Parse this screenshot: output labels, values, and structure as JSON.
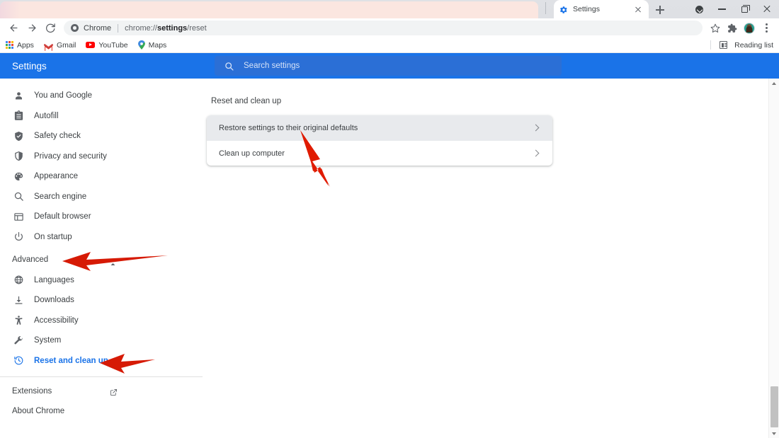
{
  "browser": {
    "tab": {
      "title": "Settings",
      "favicon": "settings-gear-icon"
    },
    "newtab_label": "+",
    "window_controls": {
      "download": "download-icon",
      "minimize": "minimize-icon",
      "maximize": "maximize-icon",
      "close": "close-icon"
    },
    "omnibox": {
      "site_label": "Chrome",
      "separator": "|",
      "url_prefix": "chrome://",
      "url_bold": "settings",
      "url_suffix": "/reset",
      "full_url": "chrome://settings/reset"
    },
    "toolbar_icons": [
      "back-icon",
      "forward-icon",
      "reload-icon",
      "bookmark-star-icon",
      "extensions-puzzle-icon",
      "profile-avatar",
      "chrome-menu-icon"
    ],
    "bookmarks": [
      {
        "label": "Apps",
        "icon": "apps-grid-icon"
      },
      {
        "label": "Gmail",
        "icon": "gmail-icon"
      },
      {
        "label": "YouTube",
        "icon": "youtube-icon"
      },
      {
        "label": "Maps",
        "icon": "maps-pin-icon"
      }
    ],
    "reading_list": {
      "label": "Reading list",
      "icon": "reading-list-icon"
    }
  },
  "settings": {
    "title": "Settings",
    "search": {
      "placeholder": "Search settings",
      "value": "",
      "icon": "search-icon"
    },
    "accent_color": "#1a73e8",
    "nav": [
      {
        "label": "You and Google",
        "icon": "person-icon",
        "active": false
      },
      {
        "label": "Autofill",
        "icon": "clipboard-icon",
        "active": false
      },
      {
        "label": "Safety check",
        "icon": "shield-check-icon",
        "active": false
      },
      {
        "label": "Privacy and security",
        "icon": "shield-icon",
        "active": false
      },
      {
        "label": "Appearance",
        "icon": "palette-icon",
        "active": false
      },
      {
        "label": "Search engine",
        "icon": "magnifier-icon",
        "active": false
      },
      {
        "label": "Default browser",
        "icon": "browser-window-icon",
        "active": false
      },
      {
        "label": "On startup",
        "icon": "power-icon",
        "active": false
      }
    ],
    "advanced": {
      "label": "Advanced",
      "expanded": true,
      "chevron": "chevron-up-icon"
    },
    "advanced_nav": [
      {
        "label": "Languages",
        "icon": "globe-icon",
        "active": false
      },
      {
        "label": "Downloads",
        "icon": "download-arrow-icon",
        "active": false
      },
      {
        "label": "Accessibility",
        "icon": "accessibility-icon",
        "active": false
      },
      {
        "label": "System",
        "icon": "wrench-icon",
        "active": false
      },
      {
        "label": "Reset and clean up",
        "icon": "restore-clock-icon",
        "active": true
      }
    ],
    "footer": [
      {
        "label": "Extensions",
        "icon": "external-link-icon"
      },
      {
        "label": "About Chrome",
        "icon": ""
      }
    ]
  },
  "main": {
    "section_title": "Reset and clean up",
    "rows": [
      {
        "label": "Restore settings to their original defaults",
        "chevron": "chevron-right-icon",
        "highlighted": true
      },
      {
        "label": "Clean up computer",
        "chevron": "chevron-right-icon",
        "highlighted": false
      }
    ]
  },
  "annotations": {
    "color": "#e01b00",
    "arrows": [
      {
        "name": "arrow-to-restore-defaults",
        "points_to": "Restore settings to their original defaults"
      },
      {
        "name": "arrow-to-advanced",
        "points_to": "Advanced"
      },
      {
        "name": "arrow-to-reset-and-clean-up",
        "points_to": "Reset and clean up"
      }
    ]
  },
  "scrollbar": {
    "position_percent": 88
  }
}
